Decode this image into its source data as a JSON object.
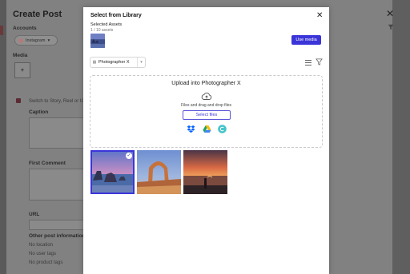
{
  "background": {
    "title": "Create Post",
    "accounts_label": "Accounts",
    "account_chip": "Instagram",
    "media_label": "Media",
    "add_symbol": "+",
    "story_toggle_text": "Switch to Story, Reel or IG TV",
    "caption_label": "Caption",
    "first_comment_label": "First Comment",
    "url_label": "URL",
    "other_info_label": "Other post information",
    "no_location": "No location",
    "no_user_tags": "No user tags",
    "no_product_tags": "No product tags"
  },
  "modal": {
    "title": "Select from Library",
    "close_symbol": "✕",
    "selected_assets_label": "Selected Assets",
    "selected_count": "1 / 10 assets",
    "use_media_label": "Use media",
    "library_select": "Photographer X",
    "upload": {
      "title": "Upload into Photographer X",
      "hint": "Files and drag and drop files",
      "select_files_label": "Select files",
      "sources": [
        "dropbox-icon",
        "google-drive-icon",
        "canva-icon"
      ]
    },
    "images": [
      {
        "name": "sea-stacks-sunset",
        "selected": true
      },
      {
        "name": "delicate-arch",
        "selected": false
      },
      {
        "name": "beach-silhouette-sunset",
        "selected": false
      }
    ]
  },
  "colors": {
    "accent": "#3b35d9",
    "overlay": "#7a7a7a"
  }
}
